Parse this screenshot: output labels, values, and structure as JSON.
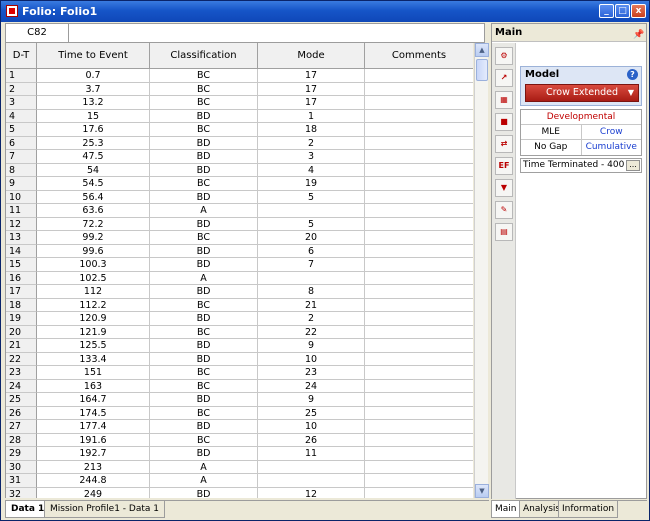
{
  "window": {
    "title": "Folio: Folio1",
    "min_label": "_",
    "max_label": "□",
    "close_label": "x"
  },
  "cellbar": {
    "ref": "C82"
  },
  "grid": {
    "headers": [
      "D-T",
      "Time to Event",
      "Classification",
      "Mode",
      "Comments"
    ],
    "rows": [
      [
        "1",
        "0.7",
        "BC",
        "17",
        ""
      ],
      [
        "2",
        "3.7",
        "BC",
        "17",
        ""
      ],
      [
        "3",
        "13.2",
        "BC",
        "17",
        ""
      ],
      [
        "4",
        "15",
        "BD",
        "1",
        ""
      ],
      [
        "5",
        "17.6",
        "BC",
        "18",
        ""
      ],
      [
        "6",
        "25.3",
        "BD",
        "2",
        ""
      ],
      [
        "7",
        "47.5",
        "BD",
        "3",
        ""
      ],
      [
        "8",
        "54",
        "BD",
        "4",
        ""
      ],
      [
        "9",
        "54.5",
        "BC",
        "19",
        ""
      ],
      [
        "10",
        "56.4",
        "BD",
        "5",
        ""
      ],
      [
        "11",
        "63.6",
        "A",
        "",
        ""
      ],
      [
        "12",
        "72.2",
        "BD",
        "5",
        ""
      ],
      [
        "13",
        "99.2",
        "BC",
        "20",
        ""
      ],
      [
        "14",
        "99.6",
        "BD",
        "6",
        ""
      ],
      [
        "15",
        "100.3",
        "BD",
        "7",
        ""
      ],
      [
        "16",
        "102.5",
        "A",
        "",
        ""
      ],
      [
        "17",
        "112",
        "BD",
        "8",
        ""
      ],
      [
        "18",
        "112.2",
        "BC",
        "21",
        ""
      ],
      [
        "19",
        "120.9",
        "BD",
        "2",
        ""
      ],
      [
        "20",
        "121.9",
        "BC",
        "22",
        ""
      ],
      [
        "21",
        "125.5",
        "BD",
        "9",
        ""
      ],
      [
        "22",
        "133.4",
        "BD",
        "10",
        ""
      ],
      [
        "23",
        "151",
        "BC",
        "23",
        ""
      ],
      [
        "24",
        "163",
        "BC",
        "24",
        ""
      ],
      [
        "25",
        "164.7",
        "BD",
        "9",
        ""
      ],
      [
        "26",
        "174.5",
        "BC",
        "25",
        ""
      ],
      [
        "27",
        "177.4",
        "BD",
        "10",
        ""
      ],
      [
        "28",
        "191.6",
        "BC",
        "26",
        ""
      ],
      [
        "29",
        "192.7",
        "BD",
        "11",
        ""
      ],
      [
        "30",
        "213",
        "A",
        "",
        ""
      ],
      [
        "31",
        "244.8",
        "A",
        "",
        ""
      ],
      [
        "32",
        "249",
        "BD",
        "12",
        ""
      ]
    ]
  },
  "sheet_tabs": [
    "Data 1",
    "Mission Profile1 - Data 1"
  ],
  "panel": {
    "title": "Main",
    "model_label": "Model",
    "model_value": "Crow Extended",
    "options": [
      [
        "Developmental"
      ],
      [
        "MLE",
        "Crow"
      ],
      [
        "No Gap",
        "Cumulative"
      ]
    ],
    "termination": "Time Terminated - 400",
    "ellipsis": "...",
    "tabs": [
      "Main",
      "Analysis",
      "Information"
    ]
  },
  "colors": {
    "titlebar": "#1655c8",
    "model_button": "#c0281e",
    "accent_red": "#c00000",
    "accent_blue": "#1a3ed0"
  }
}
